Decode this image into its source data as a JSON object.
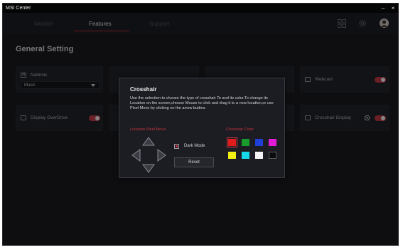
{
  "app": {
    "title": "MSI Center"
  },
  "window_controls": {
    "minimize": "–",
    "close": "×"
  },
  "tabs": [
    {
      "label": "Monitor",
      "active": false
    },
    {
      "label": "Features",
      "active": true
    },
    {
      "label": "Support",
      "active": false
    }
  ],
  "header_icons": [
    "grid-icon",
    "gear-icon",
    "avatar"
  ],
  "section": {
    "title": "General Setting"
  },
  "cards": {
    "nahimic": {
      "badge": "N",
      "label": "Nahimic",
      "select_value": "Music"
    },
    "webcam": {
      "label": "Webcam",
      "enabled": true
    },
    "display_overdrive": {
      "label": "Display OverDrive",
      "enabled": true
    },
    "crosshair_display": {
      "label": "Crosshair Display",
      "enabled": true
    }
  },
  "dialog": {
    "title": "Crosshair",
    "description": "Use the selection to choose the type of crosshair To and its color.To change its Location on the screen,choose Mouse to click and drag it to a new location,or use Pixel Move by clicking on the arrow buttins.",
    "location_label": "Location Pixel Move",
    "color_label": "Crosshair Color",
    "dark_mode_label": "Dark Mode",
    "dark_mode_checked": true,
    "reset_label": "Reset",
    "colors": [
      "#e01c1c",
      "#1a9a2a",
      "#1f3fd6",
      "#e21bd6",
      "#f2ee12",
      "#17d8e8",
      "#f4f4f4",
      "#0c0c0c"
    ],
    "selected_color_index": 0
  },
  "colors": {
    "accent": "#c62f3a",
    "background": "#1a1b20",
    "card": "#222329"
  }
}
